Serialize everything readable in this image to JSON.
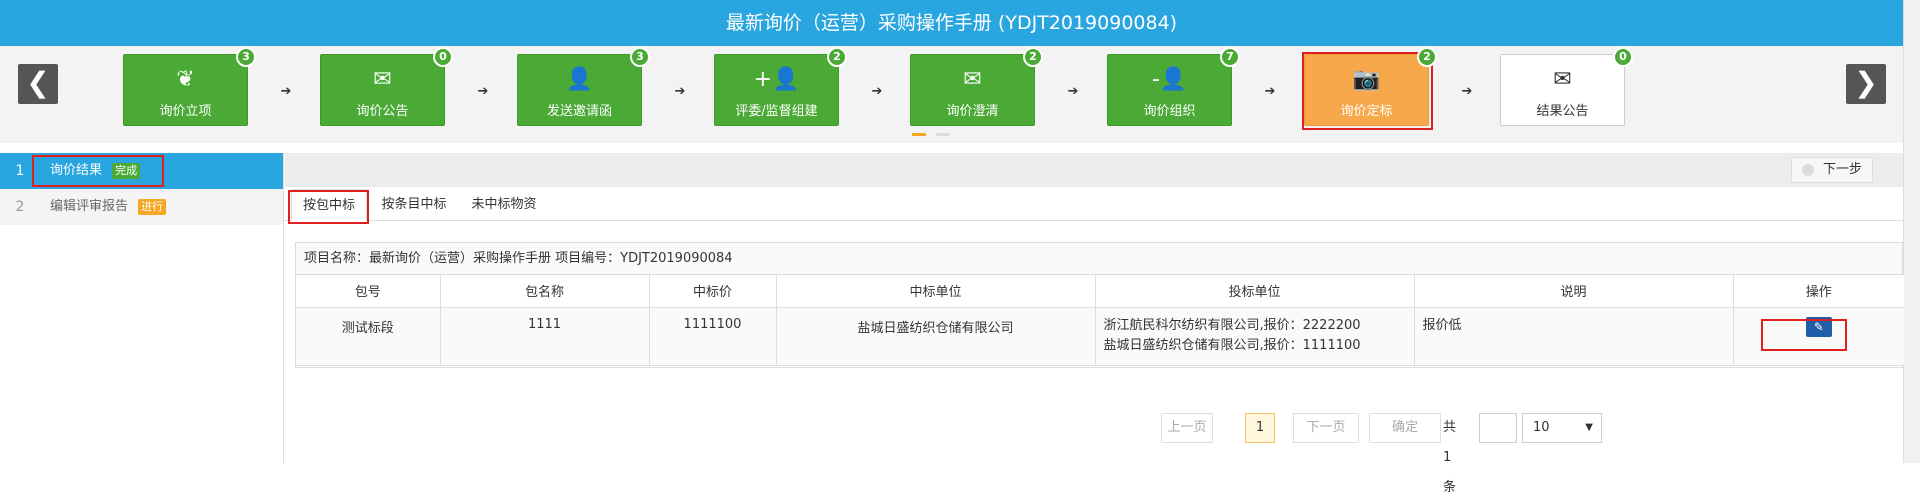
{
  "header": {
    "title": "最新询价（运营）采购操作手册 (YDJT2019090084)"
  },
  "nav": {
    "prev_icon": "chevron-left-icon",
    "next_icon": "chevron-right-icon",
    "prev_glyph": "❮",
    "next_glyph": "❯"
  },
  "steps": [
    {
      "label": "询价立项",
      "count": "3",
      "icon": "leaf-icon",
      "glyph": "❦",
      "state": "green"
    },
    {
      "label": "询价公告",
      "count": "0",
      "icon": "envelope-icon",
      "glyph": "✉",
      "state": "green"
    },
    {
      "label": "发送邀请函",
      "count": "3",
      "icon": "user-icon",
      "glyph": "👤",
      "state": "green"
    },
    {
      "label": "评委/监督组建",
      "count": "2",
      "icon": "user-add-icon",
      "glyph": "+👤",
      "state": "green"
    },
    {
      "label": "询价澄清",
      "count": "2",
      "icon": "envelope-icon",
      "glyph": "✉",
      "state": "green"
    },
    {
      "label": "询价组织",
      "count": "7",
      "icon": "user-remove-icon",
      "glyph": "-👤",
      "state": "green"
    },
    {
      "label": "询价定标",
      "count": "2",
      "icon": "camera-icon",
      "glyph": "📷",
      "state": "orange"
    },
    {
      "label": "结果公告",
      "count": "0",
      "icon": "envelope-icon",
      "glyph": "✉",
      "state": "white"
    }
  ],
  "step_arrow": "➔",
  "sidebar": {
    "items": [
      {
        "num": "1",
        "label": "询价结果",
        "tag": "完成"
      },
      {
        "num": "2",
        "label": "编辑评审报告",
        "tag": "进行"
      }
    ]
  },
  "toolbar": {
    "next_label": "下一步"
  },
  "tabs": [
    "按包中标",
    "按条目中标",
    "未中标物资"
  ],
  "project_info": "项目名称：最新询价（运营）采购操作手册 项目编号：YDJT2019090084",
  "table": {
    "columns": [
      "包号",
      "包名称",
      "中标价",
      "中标单位",
      "投标单位",
      "说明",
      "操作"
    ],
    "rows": [
      {
        "package_no": "测试标段",
        "package_name": "1111",
        "winning_price": "1111100",
        "winner": "盐城日盛纺织仓储有限公司",
        "bidders": [
          "浙江航民科尔纺织有限公司,报价：2222200",
          "盐城日盛纺织仓储有限公司,报价：1111100"
        ],
        "note": "报价低",
        "action_icon": "edit-icon",
        "action_glyph": "✎"
      }
    ]
  },
  "pager": {
    "prev": "上一页",
    "current": "1",
    "next": "下一页",
    "confirm": "确定",
    "total": "共1条",
    "page_size": "10"
  },
  "colors": {
    "header_blue": "#29a5df",
    "step_green": "#4aaa35",
    "step_orange": "#f7a84a",
    "highlight_red": "#e02020",
    "action_blue": "#1f5ea8"
  }
}
